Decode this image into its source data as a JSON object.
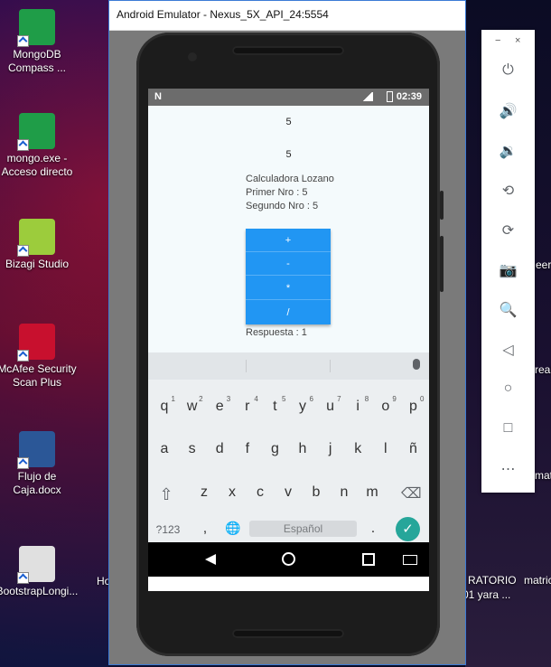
{
  "desktop": {
    "icons": [
      {
        "label": "MongoDB Compass ...",
        "color": "#1f9d48"
      },
      {
        "label": "mongo.exe - Acceso directo",
        "color": "#1f9d48"
      },
      {
        "label": "Bizagi Studio",
        "color": "#9ccc3c"
      },
      {
        "label": "McAfee Security Scan Plus",
        "color": "#c8102e"
      },
      {
        "label": "Flujo de Caja.docx",
        "color": "#2b5797"
      },
      {
        "label": "BootstrapLongi...",
        "color": "#e0e0e0"
      }
    ],
    "partial_labels": {
      "ho": "Ho",
      "eer": "eer",
      "real": "real",
      "matri1": "matri",
      "ratorio": "RATORIO",
      "yara": "01 yara ...",
      "matri2": "matric"
    }
  },
  "emulator": {
    "title": "Android Emulator - Nexus_5X_API_24:5554",
    "statusbar": {
      "left_icon": "N",
      "time": "02:39"
    },
    "app": {
      "number1": "5",
      "number2": "5",
      "title": "Calculadora Lozano",
      "first": "Primer Nro : 5",
      "second": "Segundo Nro : 5",
      "buttons": [
        "+",
        "-",
        "*",
        "/"
      ],
      "result": "Respuesta : 1"
    },
    "keyboard": {
      "row1": [
        {
          "k": "q",
          "n": "1"
        },
        {
          "k": "w",
          "n": "2"
        },
        {
          "k": "e",
          "n": "3"
        },
        {
          "k": "r",
          "n": "4"
        },
        {
          "k": "t",
          "n": "5"
        },
        {
          "k": "y",
          "n": "6"
        },
        {
          "k": "u",
          "n": "7"
        },
        {
          "k": "i",
          "n": "8"
        },
        {
          "k": "o",
          "n": "9"
        },
        {
          "k": "p",
          "n": "0"
        }
      ],
      "row2": [
        "a",
        "s",
        "d",
        "f",
        "g",
        "h",
        "j",
        "k",
        "l",
        "ñ"
      ],
      "row3": [
        "z",
        "x",
        "c",
        "v",
        "b",
        "n",
        "m"
      ],
      "symbols_key": "?123",
      "comma_key": ",",
      "space_label": "Español",
      "period_key": ".",
      "enter_icon": "✓"
    }
  },
  "side_panel": {
    "minimize": "−",
    "close": "×",
    "tools": [
      {
        "name": "power-icon",
        "glyph": "⏻"
      },
      {
        "name": "volume-up-icon",
        "glyph": "🔊"
      },
      {
        "name": "volume-down-icon",
        "glyph": "🔉"
      },
      {
        "name": "rotate-left-icon",
        "glyph": "⟲"
      },
      {
        "name": "rotate-right-icon",
        "glyph": "⟳"
      },
      {
        "name": "camera-icon",
        "glyph": "📷"
      },
      {
        "name": "zoom-icon",
        "glyph": "🔍"
      },
      {
        "name": "back-icon",
        "glyph": "◁"
      },
      {
        "name": "home-icon",
        "glyph": "○"
      },
      {
        "name": "overview-icon",
        "glyph": "□"
      },
      {
        "name": "more-icon",
        "glyph": "⋯"
      }
    ]
  }
}
